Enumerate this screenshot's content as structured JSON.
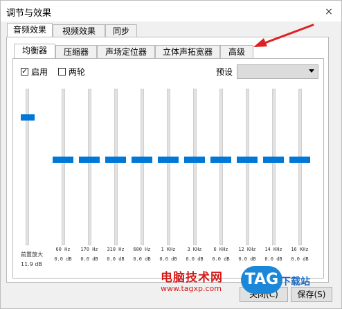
{
  "window": {
    "title": "调节与效果",
    "close_glyph": "×"
  },
  "top_tabs": [
    "音频效果",
    "视频效果",
    "同步"
  ],
  "sub_tabs": [
    "均衡器",
    "压缩器",
    "声场定位器",
    "立体声拓宽器",
    "高级"
  ],
  "controls": {
    "enable_label": "启用",
    "enable_checked": true,
    "two_pass_label": "两轮",
    "two_pass_checked": false,
    "preset_label": "预设",
    "preset_value": ""
  },
  "preamp": {
    "label": "前置放大",
    "value_label": "11.9 dB",
    "level": 0.83
  },
  "bands": [
    {
      "freq": "60 Hz",
      "gain": "0.0 dB"
    },
    {
      "freq": "170 Hz",
      "gain": "0.0 dB"
    },
    {
      "freq": "310 Hz",
      "gain": "0.0 dB"
    },
    {
      "freq": "600 Hz",
      "gain": "0.0 dB"
    },
    {
      "freq": "1 KHz",
      "gain": "0.0 dB"
    },
    {
      "freq": "3 KHz",
      "gain": "0.0 dB"
    },
    {
      "freq": "6 KHz",
      "gain": "0.0 dB"
    },
    {
      "freq": "12 KHz",
      "gain": "0.0 dB"
    },
    {
      "freq": "14 KHz",
      "gain": "0.0 dB"
    },
    {
      "freq": "16 KHz",
      "gain": "0.0 dB"
    }
  ],
  "buttons": {
    "close_label": "关闭(C)",
    "save_label": "保存(S)"
  },
  "watermark": {
    "site_text": "电脑技术网",
    "url": "www.tagxp.com",
    "badge": "TAG",
    "download": "下载站"
  },
  "colors": {
    "slider_thumb": "#0078d7",
    "annotation_arrow": "#e02020"
  }
}
